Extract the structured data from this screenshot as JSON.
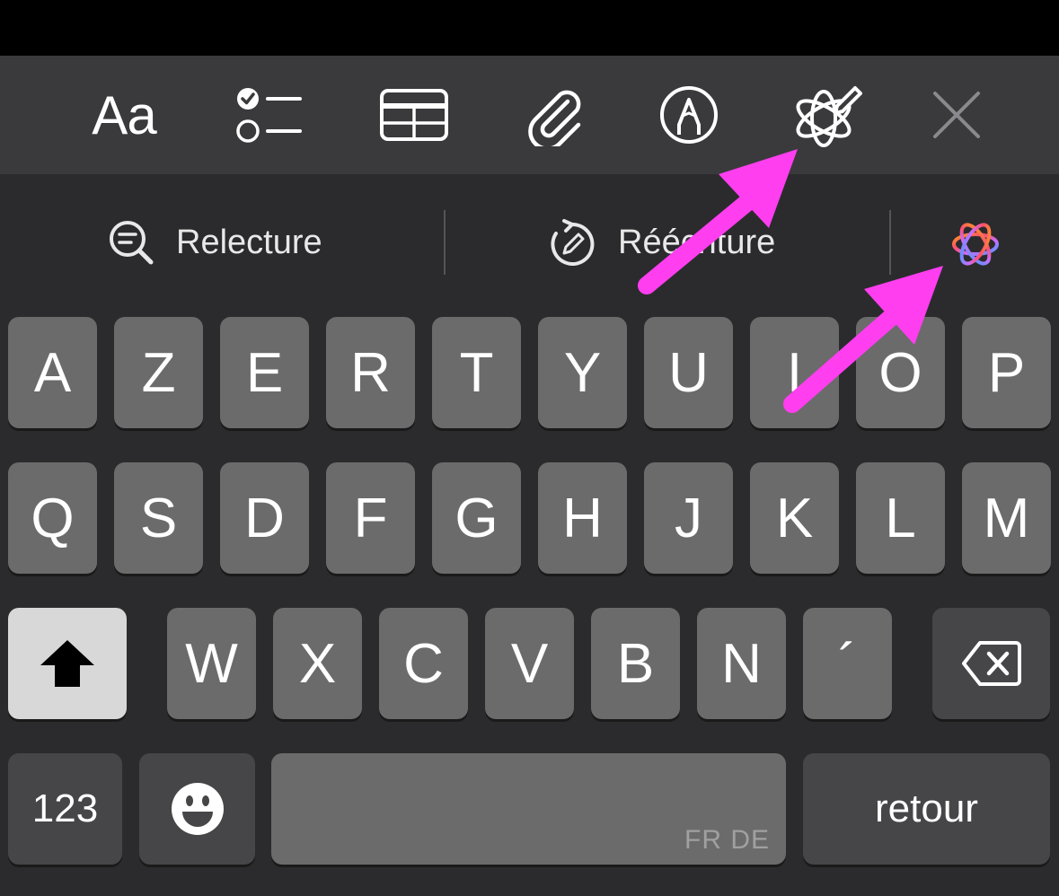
{
  "toolbar": {
    "format_label": "Aa",
    "icons": [
      "format-text-icon",
      "checklist-icon",
      "table-icon",
      "paperclip-icon",
      "markup-pen-icon",
      "writing-tools-icon",
      "close-icon"
    ]
  },
  "suggestions": {
    "items": [
      {
        "label": "Relecture",
        "icon": "proofread-magnifier-icon"
      },
      {
        "label": "Réécriture",
        "icon": "rewrite-icon"
      }
    ],
    "ai_icon": "apple-intelligence-icon"
  },
  "keyboard": {
    "row1": [
      "A",
      "Z",
      "E",
      "R",
      "T",
      "Y",
      "U",
      "I",
      "O",
      "P"
    ],
    "row2": [
      "Q",
      "S",
      "D",
      "F",
      "G",
      "H",
      "J",
      "K",
      "L",
      "M"
    ],
    "row3": [
      "W",
      "X",
      "C",
      "V",
      "B",
      "N",
      "´"
    ],
    "numbers_label": "123",
    "space_hint": "FR DE",
    "return_label": "retour"
  },
  "colors": {
    "toolbar_bg": "#3a3a3c",
    "keyboard_bg": "#2b2b2d",
    "key_bg": "#6b6b6b",
    "annotation_arrow": "#ff3ef0"
  }
}
